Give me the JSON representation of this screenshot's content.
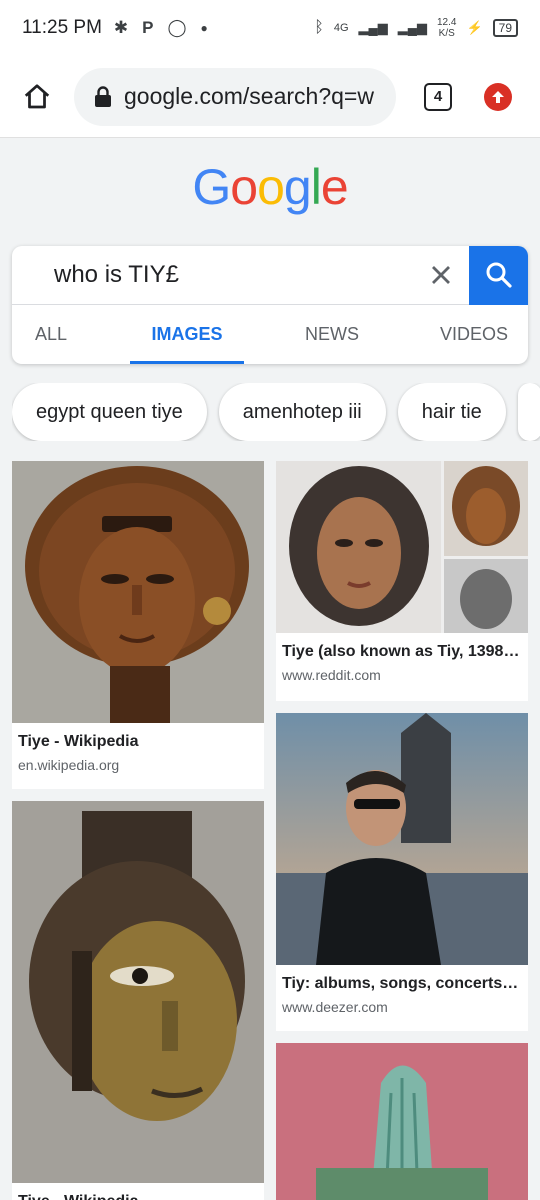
{
  "status": {
    "time": "11:25 PM",
    "network": "4G",
    "speed_top": "12.4",
    "speed_unit": "K/S",
    "battery": "79"
  },
  "browser": {
    "url": "google.com/search?q=w",
    "tab_count": "4"
  },
  "logo": [
    "G",
    "o",
    "o",
    "g",
    "l",
    "e"
  ],
  "logo_colors": [
    "#4285f4",
    "#ea4335",
    "#fbbc05",
    "#4285f4",
    "#34a853",
    "#ea4335"
  ],
  "search": {
    "query": "who is TIY£"
  },
  "tabs": [
    "ALL",
    "IMAGES",
    "NEWS",
    "VIDEOS"
  ],
  "active_tab": "IMAGES",
  "chips": [
    "egypt queen tiye",
    "amenhotep iii",
    "hair tie"
  ],
  "results": [
    {
      "title": "Tiye - Wikipedia",
      "source": "en.wikipedia.org"
    },
    {
      "title": "Tiye (also known as Tiy, 1398…",
      "source": "www.reddit.com"
    },
    {
      "title": "Tiy: albums, songs, concerts |…",
      "source": "www.deezer.com"
    },
    {
      "title": "Tiye - Wikipedia",
      "source": ""
    }
  ],
  "colors": {
    "accent": "#1a73e8",
    "update": "#d93025"
  }
}
